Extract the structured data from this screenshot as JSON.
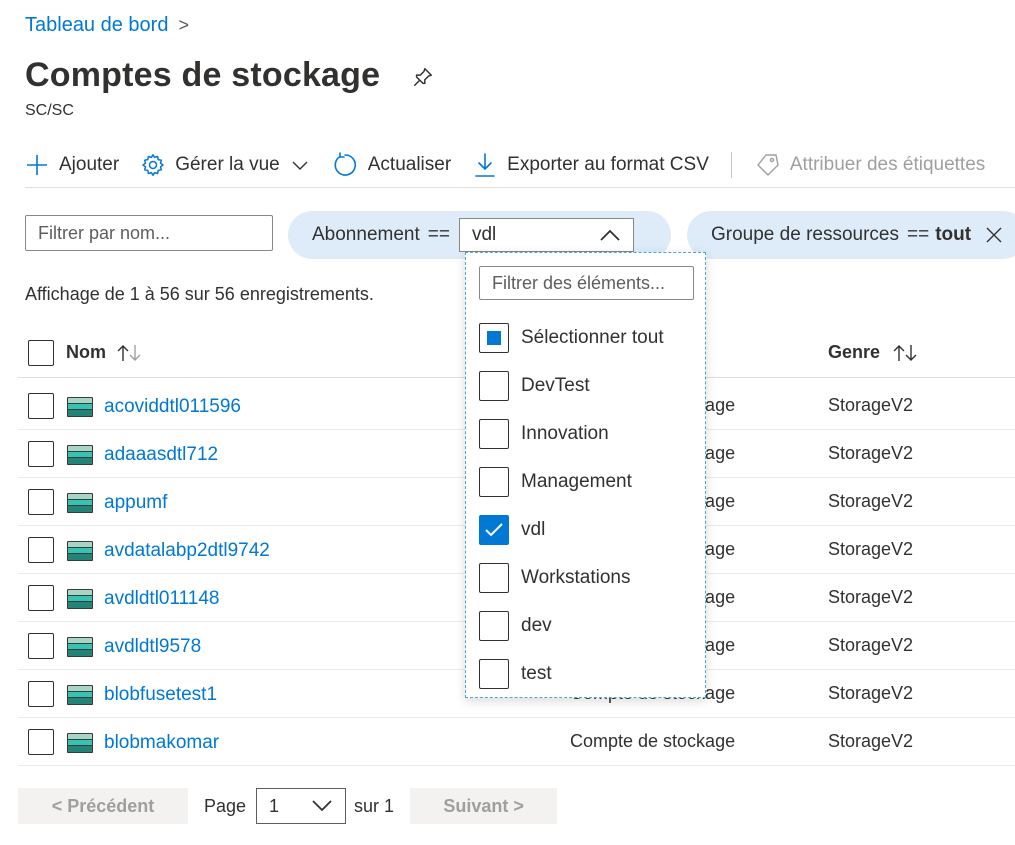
{
  "breadcrumb": {
    "home": "Tableau de bord",
    "separator": ">"
  },
  "page": {
    "title": "Comptes de stockage",
    "subtitle": "SC/SC"
  },
  "toolbar": {
    "add": "Ajouter",
    "manage_view": "Gérer la vue",
    "refresh": "Actualiser",
    "export_csv": "Exporter au format CSV",
    "assign_tags": "Attribuer des étiquettes"
  },
  "filters": {
    "name_placeholder": "Filtrer par nom...",
    "subscription": {
      "label": "Abonnement",
      "operator": "==",
      "value": "vdl"
    },
    "resource_group": {
      "label": "Groupe de ressources",
      "operator": "==",
      "value": "tout"
    }
  },
  "records_text": "Affichage de 1 à 56 sur 56 enregistrements.",
  "table": {
    "columns": {
      "name": "Nom",
      "kind": "Genre"
    },
    "rows": [
      {
        "name": "acoviddtl011596",
        "type": "Compte de stockage",
        "kind": "StorageV2"
      },
      {
        "name": "adaaasdtl712",
        "type": "Compte de stockage",
        "kind": "StorageV2"
      },
      {
        "name": "appumf",
        "type": "Compte de stockage",
        "kind": "StorageV2"
      },
      {
        "name": "avdatalabp2dtl9742",
        "type": "Compte de stockage",
        "kind": "StorageV2"
      },
      {
        "name": "avdldtl011148",
        "type": "Compte de stockage",
        "kind": "StorageV2"
      },
      {
        "name": "avdldtl9578",
        "type": "Compte de stockage",
        "kind": "StorageV2"
      },
      {
        "name": "blobfusetest1",
        "type": "Compte de stockage",
        "kind": "StorageV2"
      },
      {
        "name": "blobmakomar",
        "type": "Compte de stockage",
        "kind": "StorageV2"
      }
    ]
  },
  "dropdown": {
    "search_placeholder": "Filtrer des éléments...",
    "items": [
      {
        "label": "Sélectionner tout",
        "state": "partial"
      },
      {
        "label": "DevTest",
        "state": "unchecked"
      },
      {
        "label": "Innovation",
        "state": "unchecked"
      },
      {
        "label": "Management",
        "state": "unchecked"
      },
      {
        "label": "vdl",
        "state": "checked"
      },
      {
        "label": "Workstations",
        "state": "unchecked"
      },
      {
        "label": "dev",
        "state": "unchecked"
      },
      {
        "label": "test",
        "state": "unchecked"
      }
    ]
  },
  "pagination": {
    "prev": "< Précédent",
    "page_label": "Page",
    "current": "1",
    "of_label": "sur 1",
    "next": "Suivant >"
  },
  "colors": {
    "accent": "#0078d4",
    "pill_bg": "#deecf9",
    "text": "#323130",
    "disabled": "#a19f9d"
  }
}
